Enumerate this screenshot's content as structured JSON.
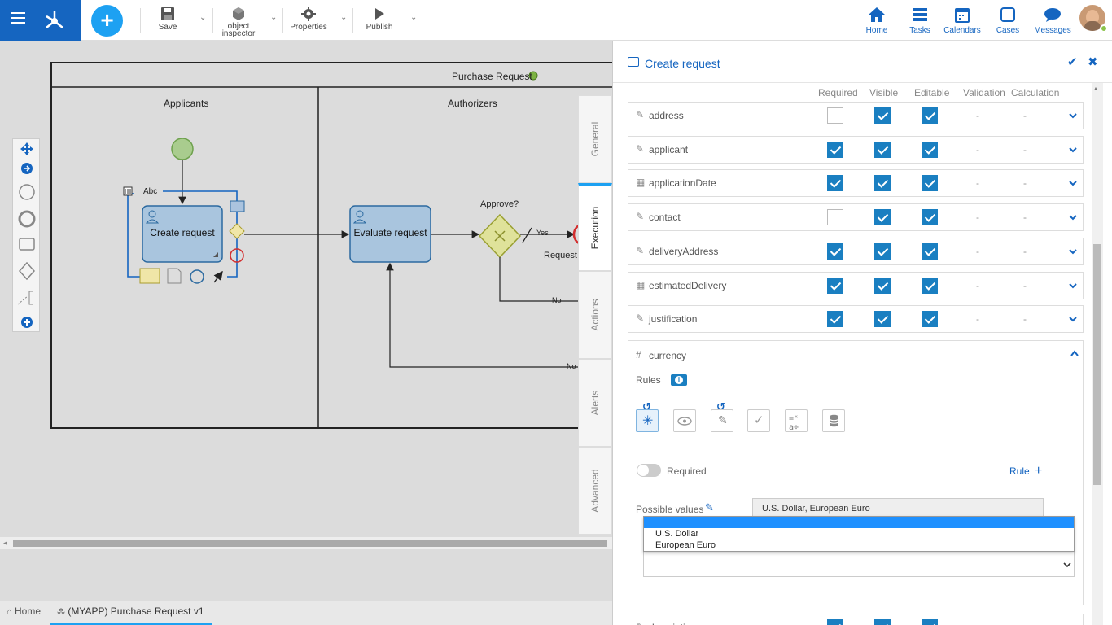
{
  "toolbar": {
    "save_label": "Save",
    "object_inspector_label_1": "object",
    "object_inspector_label_2": "inspector",
    "properties_label": "Properties",
    "publish_label": "Publish"
  },
  "nav": {
    "home": "Home",
    "tasks": "Tasks",
    "calendars": "Calendars",
    "cases": "Cases",
    "messages": "Messages"
  },
  "diagram": {
    "pool_title": "Purchase Request",
    "lane_applicants": "Applicants",
    "lane_authorizers": "Authorizers",
    "task_create": "Create request",
    "task_evaluate": "Evaluate request",
    "gateway_label": "Approve?",
    "flow_yes": "Yes",
    "flow_no_1": "No",
    "flow_no_2": "No",
    "end_label": "Request",
    "text_annotation": "Abc"
  },
  "vertical_tabs": [
    "General",
    "Execution",
    "Actions",
    "Alerts",
    "Advanced"
  ],
  "bottom_tabs": {
    "home": "Home",
    "process": "(MYAPP) Purchase Request v1"
  },
  "panel": {
    "title": "Create request",
    "columns": [
      "Required",
      "Visible",
      "Editable",
      "Validation",
      "Calculation"
    ],
    "rows": [
      {
        "name": "address",
        "icon": "edit-icon",
        "required": false,
        "visible": true,
        "editable": true,
        "validation": "-",
        "calculation": "-"
      },
      {
        "name": "applicant",
        "icon": "edit-icon",
        "required": true,
        "visible": true,
        "editable": true,
        "validation": "-",
        "calculation": "-"
      },
      {
        "name": "applicationDate",
        "icon": "calendar-icon",
        "required": true,
        "visible": true,
        "editable": true,
        "validation": "-",
        "calculation": "-"
      },
      {
        "name": "contact",
        "icon": "edit-icon",
        "required": false,
        "visible": true,
        "editable": true,
        "validation": "-",
        "calculation": "-"
      },
      {
        "name": "deliveryAddress",
        "icon": "edit-icon",
        "required": true,
        "visible": true,
        "editable": true,
        "validation": "-",
        "calculation": "-"
      },
      {
        "name": "estimatedDelivery",
        "icon": "calendar-icon",
        "required": true,
        "visible": true,
        "editable": true,
        "validation": "-",
        "calculation": "-"
      },
      {
        "name": "justification",
        "icon": "edit-icon",
        "required": true,
        "visible": true,
        "editable": true,
        "validation": "-",
        "calculation": "-"
      }
    ],
    "expanded": {
      "name": "currency",
      "rules_label": "Rules",
      "required_label": "Required",
      "rule_add_label": "Rule",
      "possible_values_label": "Possible values",
      "possible_values_value": "U.S. Dollar, European Euro",
      "options": [
        "U.S. Dollar",
        "European Euro"
      ]
    },
    "last_row": {
      "name": "description",
      "icon": "edit-icon",
      "required": true,
      "visible": true,
      "editable": true,
      "validation": "-",
      "calculation": "-"
    },
    "dash": "-"
  },
  "colors": {
    "brand": "#1565c0",
    "accent": "#1da1f2",
    "checkbox": "#1a7fc1"
  }
}
